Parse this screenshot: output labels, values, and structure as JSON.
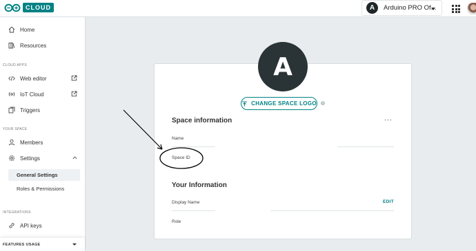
{
  "topbar": {
    "logo_text": "CLOUD",
    "space": {
      "avatar_letter": "A",
      "name": "Arduino PRO Of..."
    }
  },
  "sidebar": {
    "items": [
      {
        "label": "Home",
        "icon": "home-icon"
      },
      {
        "label": "Resources",
        "icon": "book-icon"
      }
    ],
    "cloud_apps_label": "CLOUD APPS",
    "cloud_apps": [
      {
        "label": "Web editor",
        "icon": "code-icon"
      },
      {
        "label": "IoT Cloud",
        "icon": "iot-icon"
      },
      {
        "label": "Triggers",
        "icon": "triggers-icon"
      }
    ],
    "your_space_label": "YOUR SPACE",
    "your_space": [
      {
        "label": "Members",
        "icon": "user-icon"
      },
      {
        "label": "Settings",
        "icon": "gear-icon"
      }
    ],
    "settings_sub": [
      "General Settings",
      "Roles & Permissions"
    ],
    "integrations_label": "INTEGRATIONS",
    "integrations": [
      {
        "label": "API keys",
        "icon": "link-icon"
      }
    ],
    "features_usage": "FEATURES USAGE"
  },
  "main": {
    "avatar_letter": "A",
    "change_logo_label": "CHANGE SPACE LOGO",
    "info_icon": "i",
    "space_info": {
      "title": "Space information",
      "more": "···",
      "name_label": "Name",
      "space_id_label": "Space ID"
    },
    "your_info": {
      "title": "Your Information",
      "display_name_label": "Display Name",
      "edit_label": "EDIT",
      "role_label": "Role"
    }
  },
  "colors": {
    "accent": "#008184",
    "avatar_bg": "#2a3436",
    "page_bg": "#e9ecef"
  }
}
